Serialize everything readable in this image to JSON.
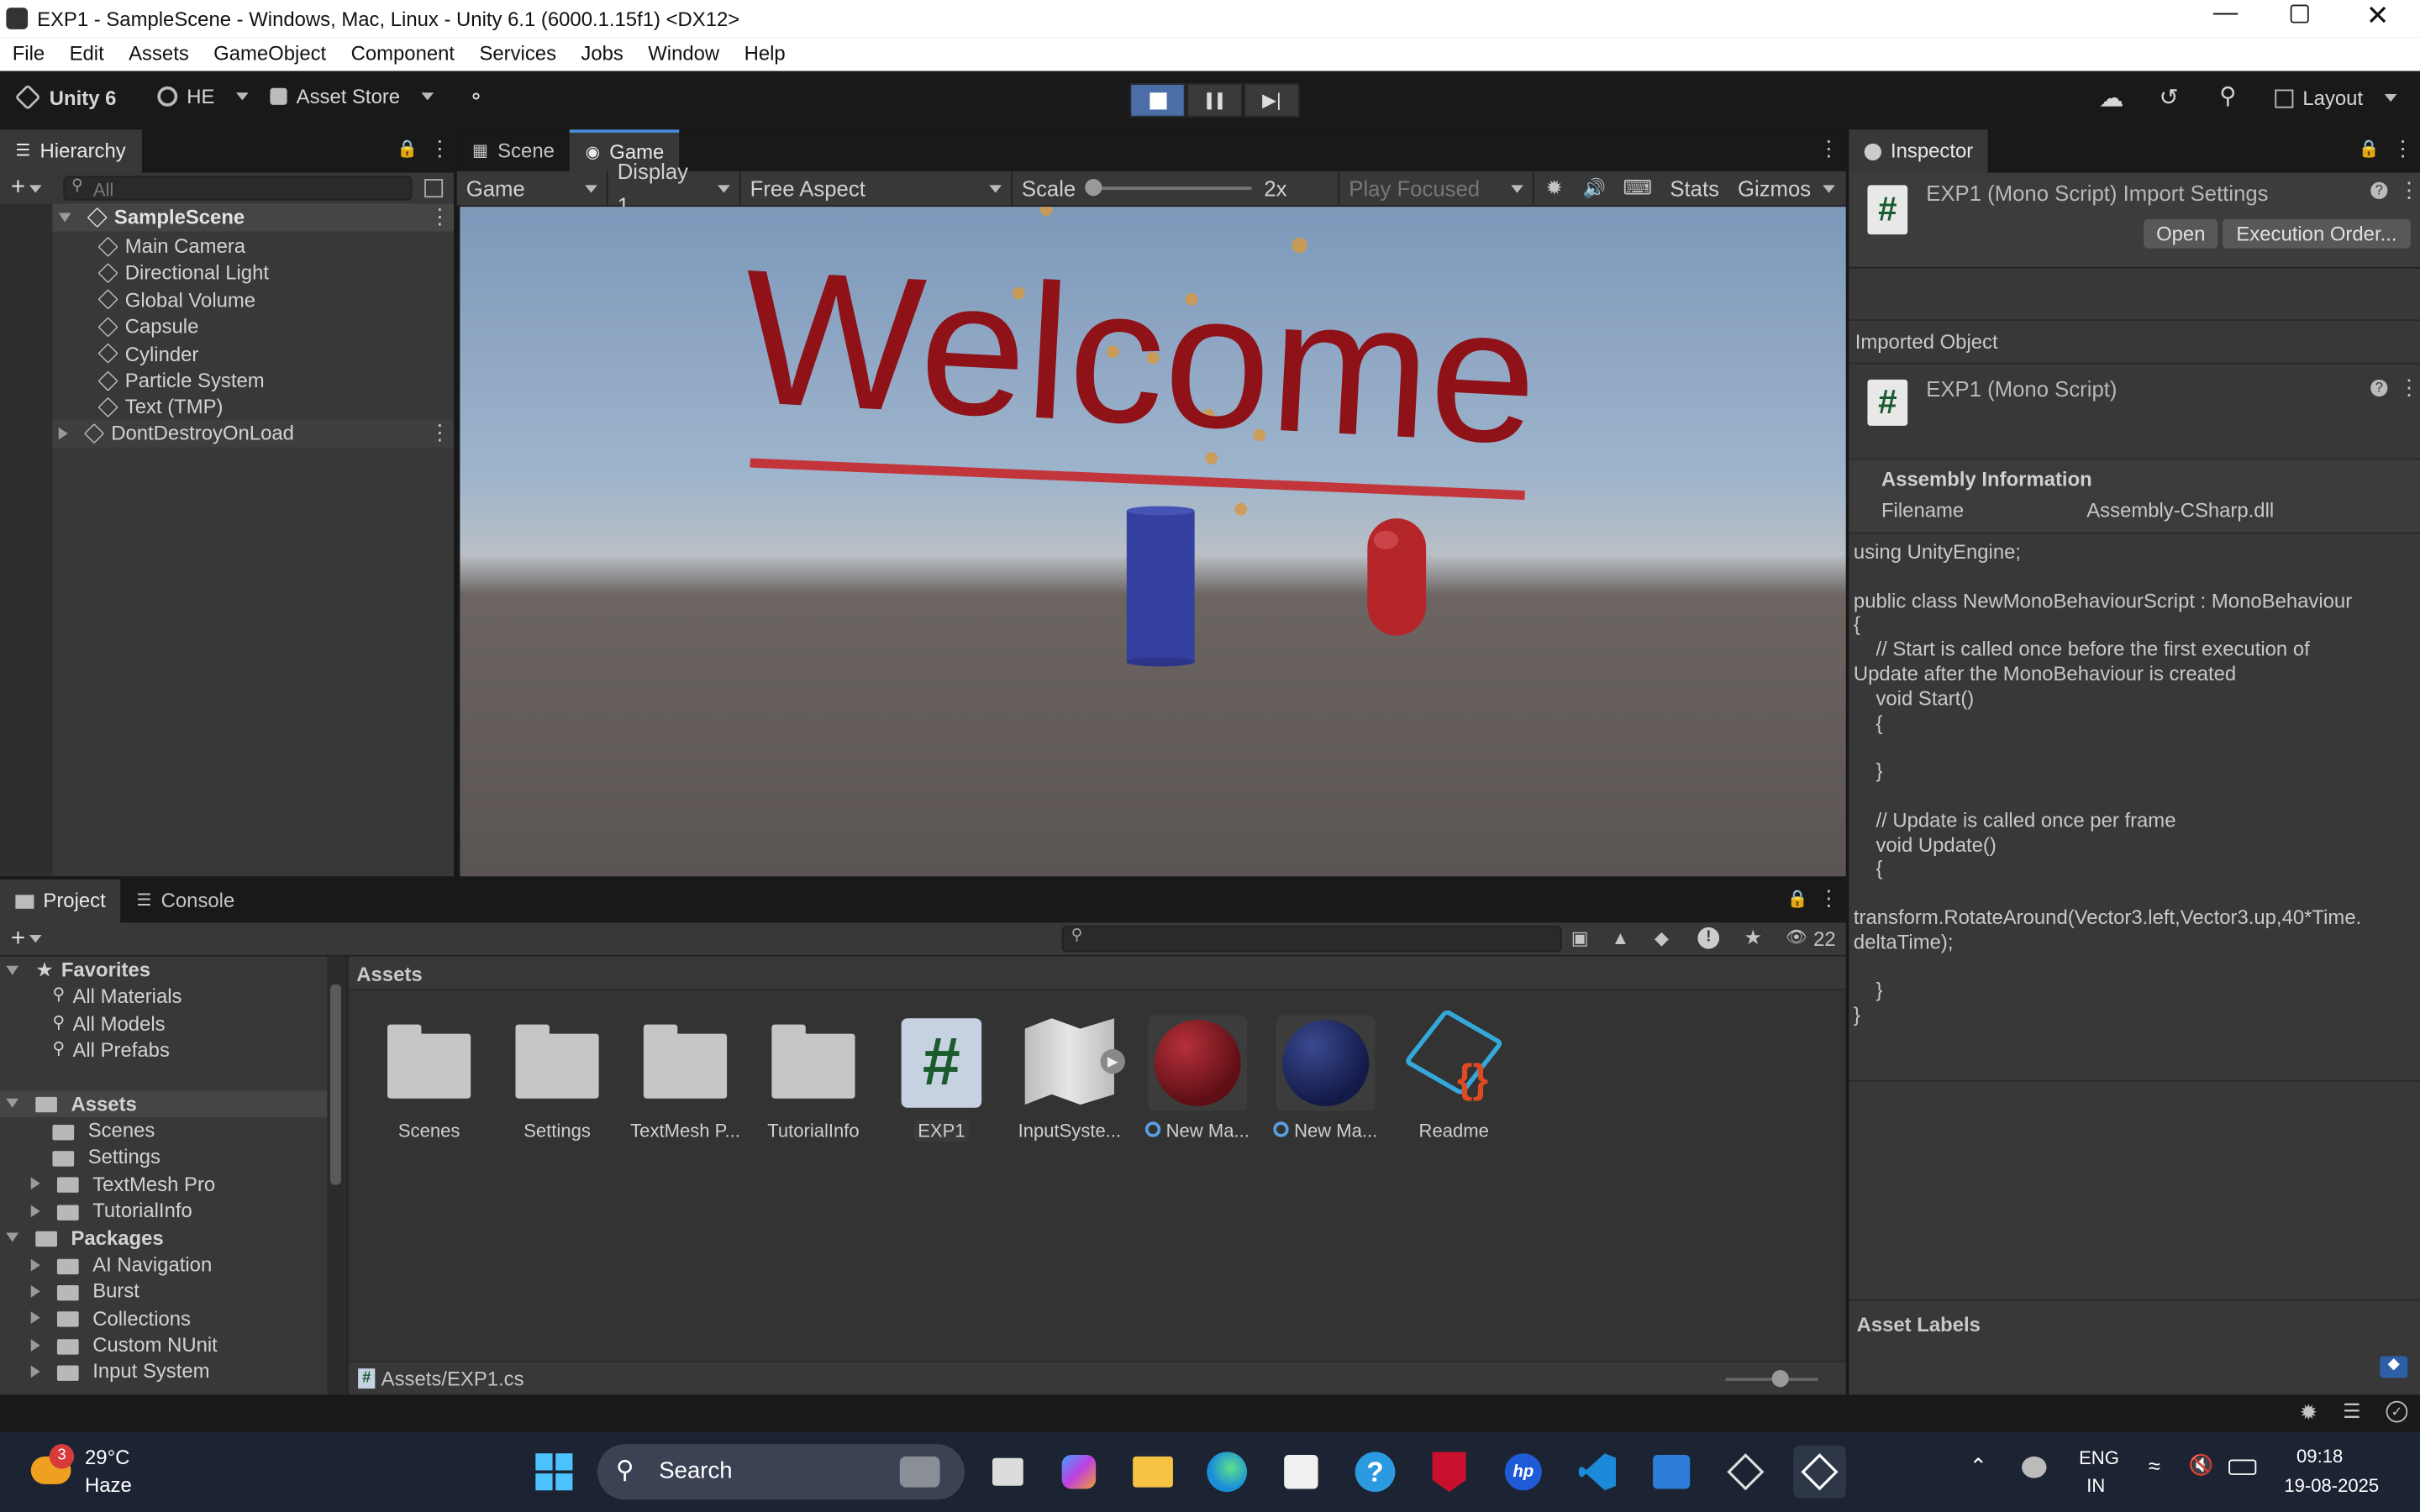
{
  "window": {
    "title": "EXP1 - SampleScene - Windows, Mac, Linux - Unity 6.1 (6000.1.15f1) <DX12>"
  },
  "menu": [
    "File",
    "Edit",
    "Assets",
    "GameObject",
    "Component",
    "Services",
    "Jobs",
    "Window",
    "Help"
  ],
  "toolbar": {
    "brand": "Unity 6",
    "account": "HE",
    "asset_store": "Asset Store",
    "layout": "Layout"
  },
  "hierarchy": {
    "tab": "Hierarchy",
    "search_placeholder": "All",
    "scene": "SampleScene",
    "items": [
      "Main Camera",
      "Directional Light",
      "Global Volume",
      "Capsule",
      "Cylinder",
      "Particle System",
      "Text (TMP)"
    ],
    "ddol": "DontDestroyOnLoad"
  },
  "game": {
    "tabs": [
      "Scene",
      "Game"
    ],
    "view_mode": "Game",
    "display": "Display 1",
    "aspect": "Free Aspect",
    "scale_label": "Scale",
    "scale_value": "2x",
    "play_focused": "Play Focused",
    "stats": "Stats",
    "gizmos": "Gizmos",
    "scene_text": "Welcome"
  },
  "inspector": {
    "tab": "Inspector",
    "header_title": "EXP1 (Mono Script) Import Settings",
    "open_btn": "Open",
    "exec_btn": "Execution Order...",
    "imported_object": "Imported Object",
    "script_name": "EXP1 (Mono Script)",
    "assembly_info": "Assembly Information",
    "filename_label": "Filename",
    "filename_value": "Assembly-CSharp.dll",
    "code": "using UnityEngine;\n\npublic class NewMonoBehaviourScript : MonoBehaviour\n{\n    // Start is called once before the first execution of\nUpdate after the MonoBehaviour is created\n    void Start()\n    {\n\n    }\n\n    // Update is called once per frame\n    void Update()\n    {\n\ntransform.RotateAround(Vector3.left,Vector3.up,40*Time.\ndeltaTime);\n\n    }\n}",
    "asset_labels": "Asset Labels"
  },
  "project": {
    "tabs": [
      "Project",
      "Console"
    ],
    "hidden_count": "22",
    "favorites": "Favorites",
    "favorite_items": [
      "All Materials",
      "All Models",
      "All Prefabs"
    ],
    "assets_root": "Assets",
    "asset_folders": [
      "Scenes",
      "Settings",
      "TextMesh Pro",
      "TutorialInfo"
    ],
    "packages_root": "Packages",
    "packages": [
      "AI Navigation",
      "Burst",
      "Collections",
      "Custom NUnit",
      "Input System"
    ],
    "breadcrumb": "Assets",
    "grid": [
      "Scenes",
      "Settings",
      "TextMesh P...",
      "TutorialInfo",
      "EXP1",
      "InputSyste...",
      "New Ma...",
      "New Ma...",
      "Readme"
    ],
    "footer_path": "Assets/EXP1.cs"
  },
  "taskbar": {
    "temp": "29°C",
    "weather": "Haze",
    "weather_badge": "3",
    "search": "Search",
    "lang1": "ENG",
    "lang2": "IN",
    "time": "09:18",
    "date": "19-08-2025"
  },
  "colors": {
    "accent": "#4b6ea8",
    "text_red": "#8e1218",
    "sky_top": "#7f9bbd",
    "ground": "#5c5654"
  }
}
